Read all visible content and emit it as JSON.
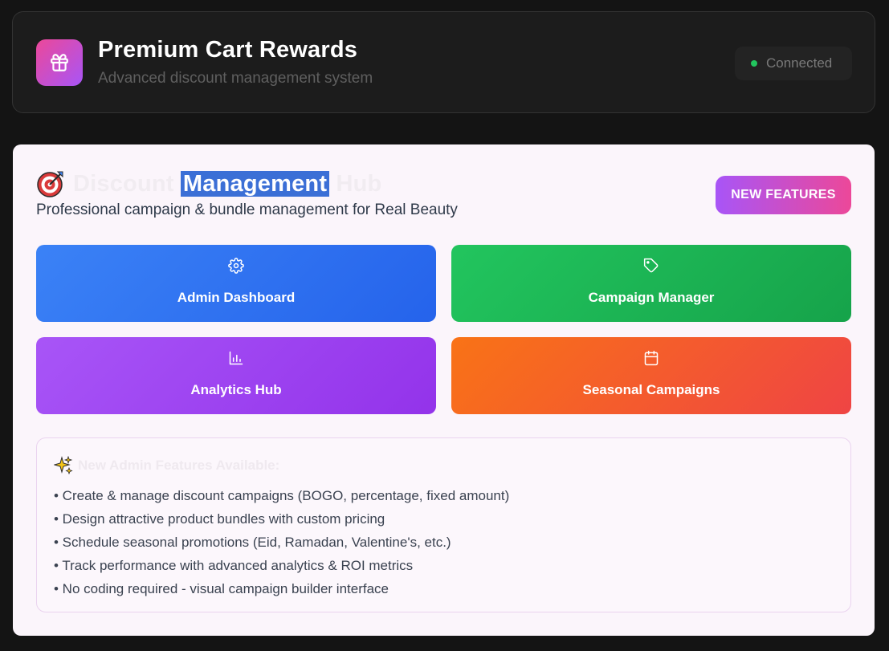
{
  "header": {
    "app_icon": "gift-icon",
    "title": "Premium Cart Rewards",
    "subtitle": "Advanced discount management system",
    "status": {
      "label": "Connected",
      "color": "#22c55e"
    }
  },
  "hub": {
    "heading_icon": "target-icon",
    "title_before": "Discount ",
    "title_selected": "Management",
    "title_after": " Hub",
    "subtitle": "Professional campaign & bundle management for Real Beauty",
    "new_features_label": "NEW FEATURES",
    "tiles": [
      {
        "label": "Admin Dashboard",
        "icon": "settings-icon",
        "color": "#3b82f6"
      },
      {
        "label": "Campaign Manager",
        "icon": "tag-icon",
        "color": "#22c55e"
      },
      {
        "label": "Analytics Hub",
        "icon": "bar-chart-icon",
        "color": "#a855f7"
      },
      {
        "label": "Seasonal Campaigns",
        "icon": "calendar-icon",
        "color": "#f97316"
      }
    ]
  },
  "features": {
    "icon": "sparkles-icon",
    "title": "New Admin Features Available:",
    "items": [
      "• Create & manage discount campaigns (BOGO, percentage, fixed amount)",
      "• Design attractive product bundles with custom pricing",
      "• Schedule seasonal promotions (Eid, Ramadan, Valentine's, etc.)",
      "• Track performance with advanced analytics & ROI metrics",
      "• No coding required - visual campaign builder interface"
    ]
  }
}
